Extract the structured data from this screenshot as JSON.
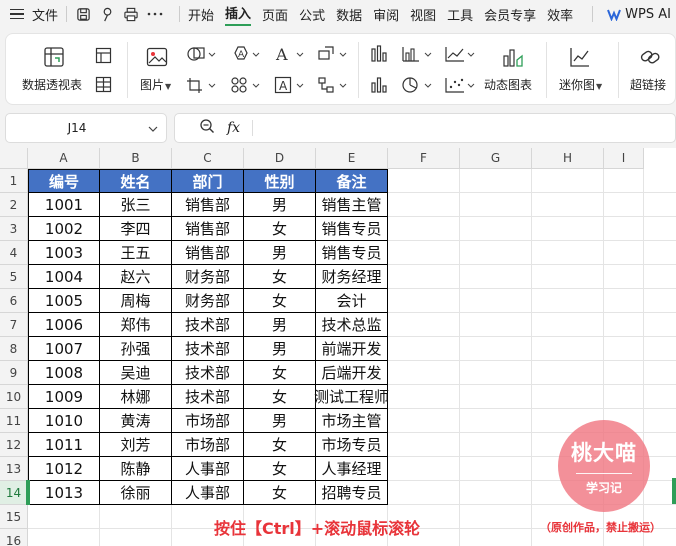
{
  "menu": {
    "file_label": "文件",
    "tabs": [
      "开始",
      "插入",
      "页面",
      "公式",
      "数据",
      "审阅",
      "视图",
      "工具",
      "会员专享",
      "效率"
    ],
    "active_tab": "插入",
    "wps_ai": "WPS AI"
  },
  "ribbon": {
    "pivot_table": "数据透视表",
    "picture": "图片",
    "dynamic_chart": "动态图表",
    "sparkline": "迷你图",
    "hyperlink": "超链接"
  },
  "formula_bar": {
    "name_box": "J14",
    "fx_label": "fx",
    "formula_value": ""
  },
  "sheet": {
    "columns": [
      "A",
      "B",
      "C",
      "D",
      "E",
      "F",
      "G",
      "H",
      "I"
    ],
    "rows": [
      "1",
      "2",
      "3",
      "4",
      "5",
      "6",
      "7",
      "8",
      "9",
      "10",
      "11",
      "12",
      "13",
      "14",
      "15",
      "16"
    ],
    "selected_row": "14",
    "table_header": [
      "编号",
      "姓名",
      "部门",
      "性别",
      "备注"
    ],
    "table_rows": [
      [
        "1001",
        "张三",
        "销售部",
        "男",
        "销售主管"
      ],
      [
        "1002",
        "李四",
        "销售部",
        "女",
        "销售专员"
      ],
      [
        "1003",
        "王五",
        "销售部",
        "男",
        "销售专员"
      ],
      [
        "1004",
        "赵六",
        "财务部",
        "女",
        "财务经理"
      ],
      [
        "1005",
        "周梅",
        "财务部",
        "女",
        "会计"
      ],
      [
        "1006",
        "郑伟",
        "技术部",
        "男",
        "技术总监"
      ],
      [
        "1007",
        "孙强",
        "技术部",
        "男",
        "前端开发"
      ],
      [
        "1008",
        "吴迪",
        "技术部",
        "女",
        "后端开发"
      ],
      [
        "1009",
        "林娜",
        "技术部",
        "女",
        "测试工程师"
      ],
      [
        "1010",
        "黄涛",
        "市场部",
        "男",
        "市场主管"
      ],
      [
        "1011",
        "刘芳",
        "市场部",
        "女",
        "市场专员"
      ],
      [
        "1012",
        "陈静",
        "人事部",
        "女",
        "人事经理"
      ],
      [
        "1013",
        "徐丽",
        "人事部",
        "女",
        "招聘专员"
      ]
    ],
    "header_color": "#4472c4"
  },
  "overlay": {
    "caption": "按住【Ctrl】+滚动鼠标滚轮",
    "copyright": "（原创作品，禁止搬运）",
    "stamp_name": "桃大喵",
    "stamp_sub": "学习记",
    "accent": "#e8343a"
  }
}
